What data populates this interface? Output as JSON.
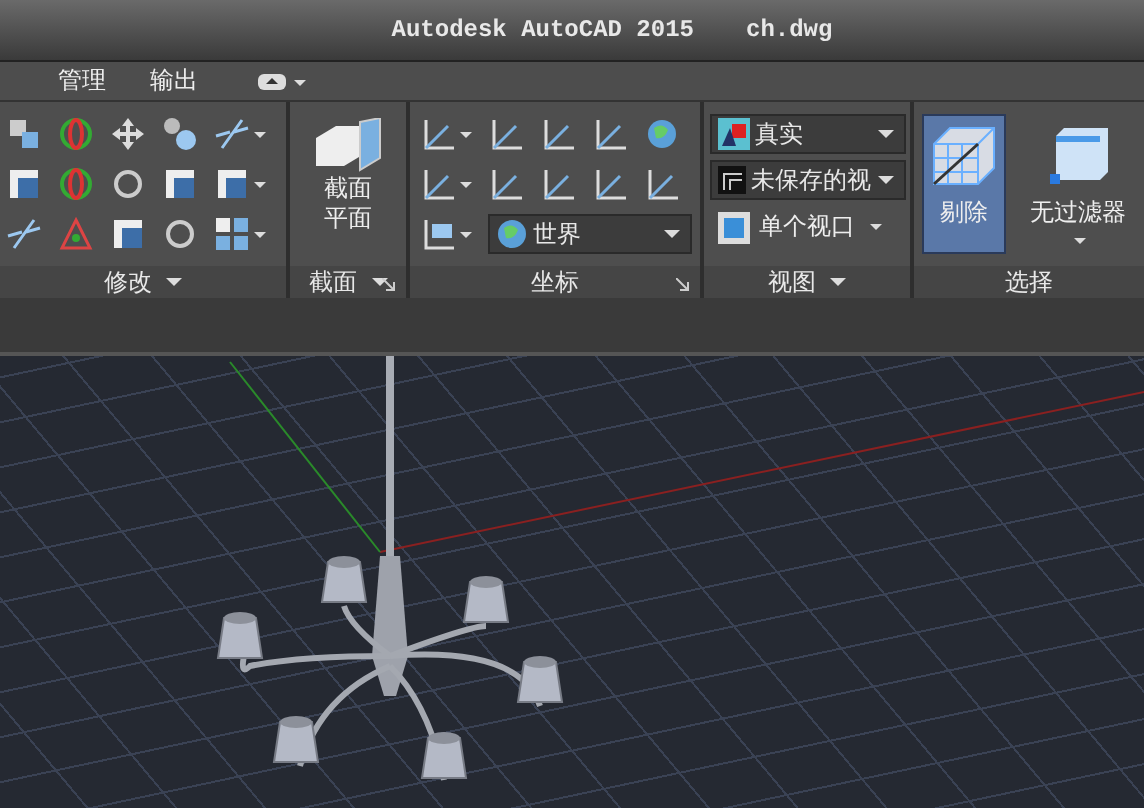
{
  "window": {
    "title": "Autodesk AutoCAD 2015",
    "file": "ch.dwg"
  },
  "ribbon_tabs": [
    {
      "label": "管理"
    },
    {
      "label": "输出"
    }
  ],
  "panels": [
    {
      "kind": "modify",
      "label": "修改",
      "menu": true,
      "launcher": false
    },
    {
      "kind": "section",
      "label": "截面",
      "menu": true,
      "launcher": true,
      "button_lines": [
        "截面",
        "平面"
      ]
    },
    {
      "kind": "coordinates",
      "label": "坐标",
      "menu": false,
      "launcher": true,
      "ucs_value": "世界"
    },
    {
      "kind": "view",
      "label": "视图",
      "menu": true,
      "launcher": false,
      "visual_style": "真实",
      "named_view": "未保存的视",
      "viewport_button": "单个视口"
    },
    {
      "kind": "selection",
      "label": "选择",
      "menu": false,
      "launcher": false,
      "buttons": [
        {
          "label": "剔除",
          "selected": true
        },
        {
          "label": "无过滤器",
          "selected": false
        }
      ]
    }
  ]
}
